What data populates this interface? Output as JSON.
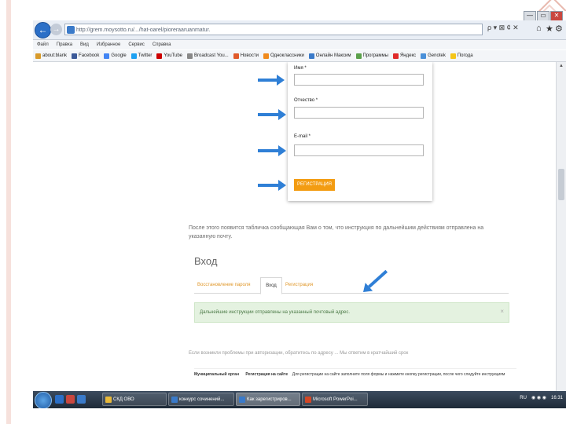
{
  "browser": {
    "address": "http://grem.moysotto.ru/.../hat-oarel/pioreraaruanmatur.",
    "addr_tools": "ρ ▾ ⊠ ¢ ✕",
    "icons": [
      "home-icon",
      "star-icon",
      "gear-icon"
    ],
    "window_controls": [
      "—",
      "▭",
      "✕"
    ]
  },
  "menu": [
    "Файл",
    "Правка",
    "Вид",
    "Избранное",
    "Сервис",
    "Справка"
  ],
  "favorites": [
    {
      "label": "about:blank",
      "color": "#d89a2b"
    },
    {
      "label": "Facebook",
      "color": "#3b5998"
    },
    {
      "label": "Google",
      "color": "#4285f4"
    },
    {
      "label": "Twitter",
      "color": "#1da1f2"
    },
    {
      "label": "YouTube",
      "color": "#cc0000"
    },
    {
      "label": "Broadcast You...",
      "color": "#888888"
    },
    {
      "label": "Новости",
      "color": "#e05a2a"
    },
    {
      "label": "Одноклассники",
      "color": "#f08a1c"
    },
    {
      "label": "Онлайн Максим",
      "color": "#3a7ac9"
    },
    {
      "label": "Программы",
      "color": "#5aa04a"
    },
    {
      "label": "Яндекс",
      "color": "#e02a2a"
    },
    {
      "label": "Genotek",
      "color": "#4a90d9"
    },
    {
      "label": "Погода",
      "color": "#f5c518"
    }
  ],
  "form": {
    "name_label": "Имя *",
    "patronymic_label": "Отчество *",
    "email_label": "E-mail *",
    "register_button": "РЕГИСТРАЦИЯ"
  },
  "info_text": "После этого появится табличка сообщающая Вам о том, что инструкция по дальнейшим действиям отправлена на указанную почту.",
  "login": {
    "title": "Вход",
    "tabs": [
      "Восстановление пароля",
      "Вход",
      "Регистрация"
    ],
    "active_tab": 1,
    "alert_text": "Дальнейшие инструкции отправлены на указанный почтовый адрес.",
    "alert_close": "×"
  },
  "footer_hint": "Если возникли проблемы при авторизации, обратитесь по адресу ... Мы ответим в кратчайший срок",
  "footer_row": {
    "col1": "Муниципальный орган",
    "col2": "Регистрация на сайте",
    "col3": "Для регистрации на сайте заполните поля формы и нажмите кнопку регистрации, после чего следуйте инструкциям"
  },
  "taskbar": {
    "items": [
      {
        "label": "СКД ОВО",
        "color": "#e8b93a"
      },
      {
        "label": "конкурс сочинений...",
        "color": "#3a7ac9"
      },
      {
        "label": "Как зарегистриров...",
        "color": "#3a7ac9"
      },
      {
        "label": "Microsoft PowerPoi...",
        "color": "#d24726"
      }
    ],
    "active_index": 2,
    "lang": "RU",
    "clock": "16:31"
  }
}
